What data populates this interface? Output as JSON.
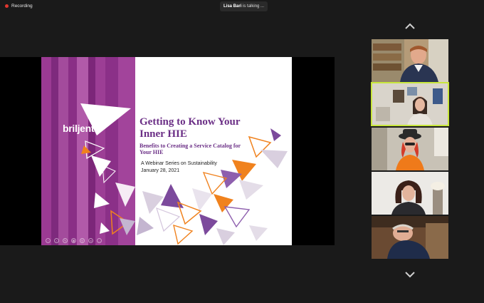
{
  "top_bar": {
    "recording_label": "Recording",
    "talking_name": "Lisa Bari",
    "talking_suffix": "is talking ..."
  },
  "slide": {
    "logo_text": "briljent",
    "title_line1": "Getting to Know Your",
    "title_line2": "Inner HIE",
    "subtitle_line1": "Benefits to Creating a Service Catalog for",
    "subtitle_line2": "Your HIE",
    "series": "A Webinar Series on Sustainability",
    "date": "January 28, 2021"
  },
  "colors": {
    "brand_purple": "#6b2f86",
    "slide_left_purple": "#8a2f86",
    "accent_orange": "#f0821e",
    "active_speaker_outline": "#c8e63c",
    "recording_red": "#e2362f"
  },
  "gallery": {
    "participants": [
      {
        "id": "participant-1",
        "active": false
      },
      {
        "id": "participant-2",
        "active": true
      },
      {
        "id": "participant-3",
        "active": false
      },
      {
        "id": "participant-4",
        "active": false
      },
      {
        "id": "participant-5",
        "active": false
      }
    ]
  },
  "icons": {
    "scroll_up": "chevron-up-icon",
    "scroll_down": "chevron-down-icon",
    "recording": "recording-dot-icon"
  }
}
